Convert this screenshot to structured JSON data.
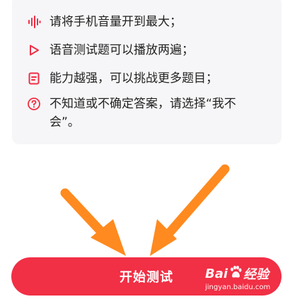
{
  "colors": {
    "accent": "#f12f45",
    "arrow": "#ff8a1f",
    "card": "#f6f6f8"
  },
  "rules": [
    {
      "icon": "sound-wave-icon",
      "text": "请将手机音量开到最大；"
    },
    {
      "icon": "play-icon",
      "text": "语音测试题可以播放两遍；"
    },
    {
      "icon": "document-icon",
      "text": "能力越强，可以挑战更多题目；"
    },
    {
      "icon": "question-circle-icon",
      "text": "不知道或不确定答案，请选择“我不会”。"
    }
  ],
  "start_button": {
    "label": "开始测试"
  },
  "watermark": {
    "brand_left": "Bai",
    "brand_right": "经验",
    "url": "jingyan.baidu.com"
  }
}
